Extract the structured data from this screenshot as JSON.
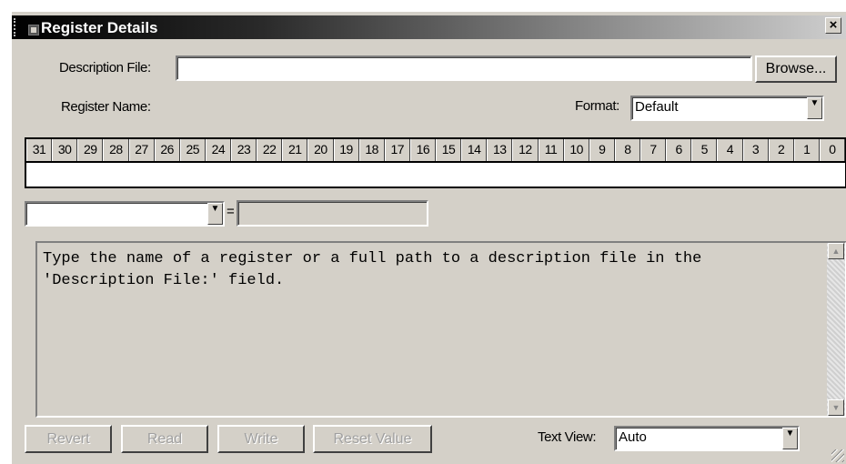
{
  "window": {
    "title": "Register Details",
    "close_label": "×"
  },
  "description_file": {
    "label": "Description File:",
    "value": "",
    "browse_label": "Browse..."
  },
  "register_name": {
    "label": "Register Name:"
  },
  "format": {
    "label": "Format:",
    "value": "Default"
  },
  "bits": [
    "31",
    "30",
    "29",
    "28",
    "27",
    "26",
    "25",
    "24",
    "23",
    "22",
    "21",
    "20",
    "19",
    "18",
    "17",
    "16",
    "15",
    "14",
    "13",
    "12",
    "11",
    "10",
    "9",
    "8",
    "7",
    "6",
    "5",
    "4",
    "3",
    "2",
    "1",
    "0"
  ],
  "field_select": {
    "value": "",
    "equals": "=",
    "result_value": ""
  },
  "memo": {
    "line1": "Type the name of a register or a full path to a description file in the",
    "line2": "'Description File:' field."
  },
  "buttons": {
    "revert": "Revert",
    "read": "Read",
    "write": "Write",
    "reset_value": "Reset Value"
  },
  "text_view": {
    "label": "Text View:",
    "value": "Auto"
  },
  "icons": {
    "arrow_down": "▼",
    "arrow_up": "▲"
  }
}
